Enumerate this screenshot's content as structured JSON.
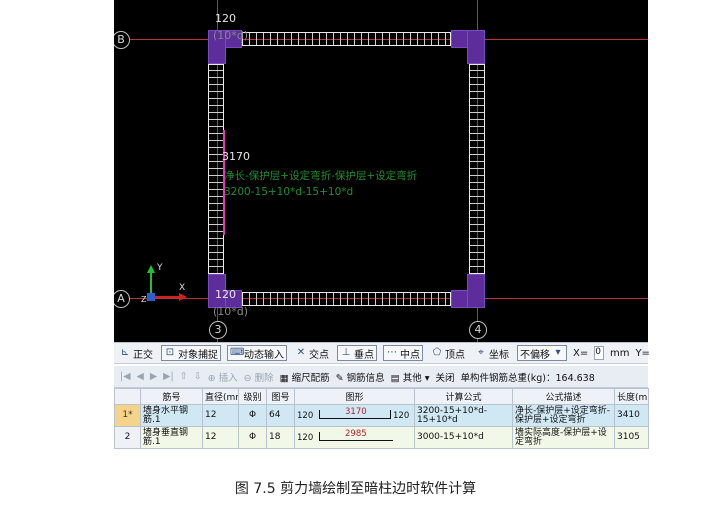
{
  "canvas": {
    "axis_labels": {
      "top_left": "B",
      "bottom_left": "A",
      "bottom_3": "3",
      "bottom_4": "4"
    },
    "dim_top": "120",
    "dim_top_sub": "(10*d)",
    "dim_bottom": "120",
    "dim_bottom_sub": "(10*d)",
    "dim_left": "3170",
    "note_line1": "净长-保护层+设定弯折-保护层+设定弯折",
    "note_line2": "3200-15+10*d-15+10*d",
    "ucs": {
      "y": "Y",
      "x": "X",
      "z": "Z"
    }
  },
  "toolbar1": {
    "items": [
      "正交",
      "对象捕捉",
      "动态输入",
      "交点",
      "垂点",
      "中点",
      "顶点",
      "坐标"
    ],
    "mode_select": "不偏移",
    "x_label": "X=",
    "x_value": "0",
    "unit": "mm",
    "y_label": "Y="
  },
  "toolbar2": {
    "insert": "插入",
    "delete": "删除",
    "scale_rebar": "缩尺配筋",
    "rebar_info": "钢筋信息",
    "other": "其他",
    "close": "关闭",
    "total_weight": "单构件钢筋总重(kg)：164.638"
  },
  "table": {
    "headers": [
      "",
      "筋号",
      "直径(mm)",
      "级别",
      "图号",
      "图形",
      "计算公式",
      "公式描述",
      "长度(mm)"
    ],
    "rows": [
      {
        "index": "1*",
        "name": "墙身水平钢筋.1",
        "diameter": "12",
        "grade": "Φ",
        "fig_no": "64",
        "shape_left": "120",
        "shape_value": "3170",
        "shape_right": "120",
        "formula": "3200-15+10*d-15+10*d",
        "description": "净长-保护层+设定弯折-保护层+设定弯折",
        "length": "3410"
      },
      {
        "index": "2",
        "name": "墙身垂直钢筋.1",
        "diameter": "12",
        "grade": "Φ",
        "fig_no": "18",
        "shape_left": "120",
        "shape_value": "2985",
        "shape_right": "",
        "formula": "3000-15+10*d",
        "description": "墙实际高度-保护层+设定弯折",
        "length": "3105"
      }
    ]
  },
  "caption": "图 7.5  剪力墙绘制至暗柱边时软件计算"
}
